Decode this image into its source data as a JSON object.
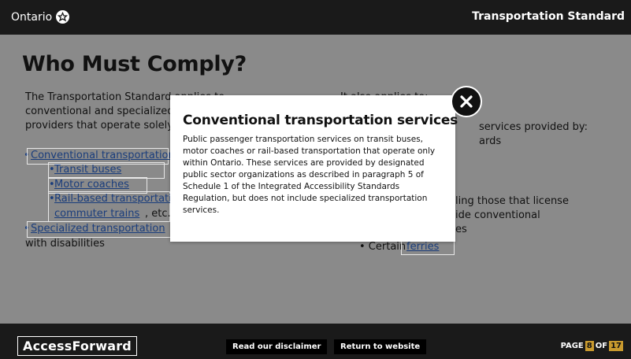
{
  "header": {
    "brand": "Ontario",
    "title": "Transportation Standard"
  },
  "page": {
    "heading": "Who Must Comply?",
    "left_lines": [
      "The Transportation Standard applies to",
      "conventional and specialized",
      "providers that operate solely"
    ],
    "right_line": "It also applies to:",
    "items": {
      "conventional": "Conventional transportation",
      "transit": "Transit buses",
      "motor": "Motor coaches",
      "rail": "Rail-based transportation",
      "commuter": "commuter trains",
      "commuter_suffix": ", etc.)",
      "specialized": "Specialized transportation",
      "with_disabilities": "with disabilities",
      "certain": "• Certain ",
      "ferries": "ferries"
    },
    "right_fragments": {
      "services": "services provided by:",
      "ards": "ards",
      "licensing": "ling those that license",
      "provide": "ide conventional",
      "es": "es"
    }
  },
  "modal": {
    "title": "Conventional transportation services",
    "body": "Public passenger transportation services on transit buses, motor coaches or rail-based transportation that operate only within Ontario. These services are provided by designated public sector organizations as described in paragraph 5 of Schedule 1 of the Integrated Accessibility Standards Regulation, but does not include specialized transportation services.",
    "close_icon": "close-icon"
  },
  "footer": {
    "logo": "AccessForward",
    "disclaimer": "Read our disclaimer",
    "return": "Return to website",
    "page_label": "PAGE",
    "page_current": "8",
    "of_label": "OF",
    "page_total": "17"
  }
}
